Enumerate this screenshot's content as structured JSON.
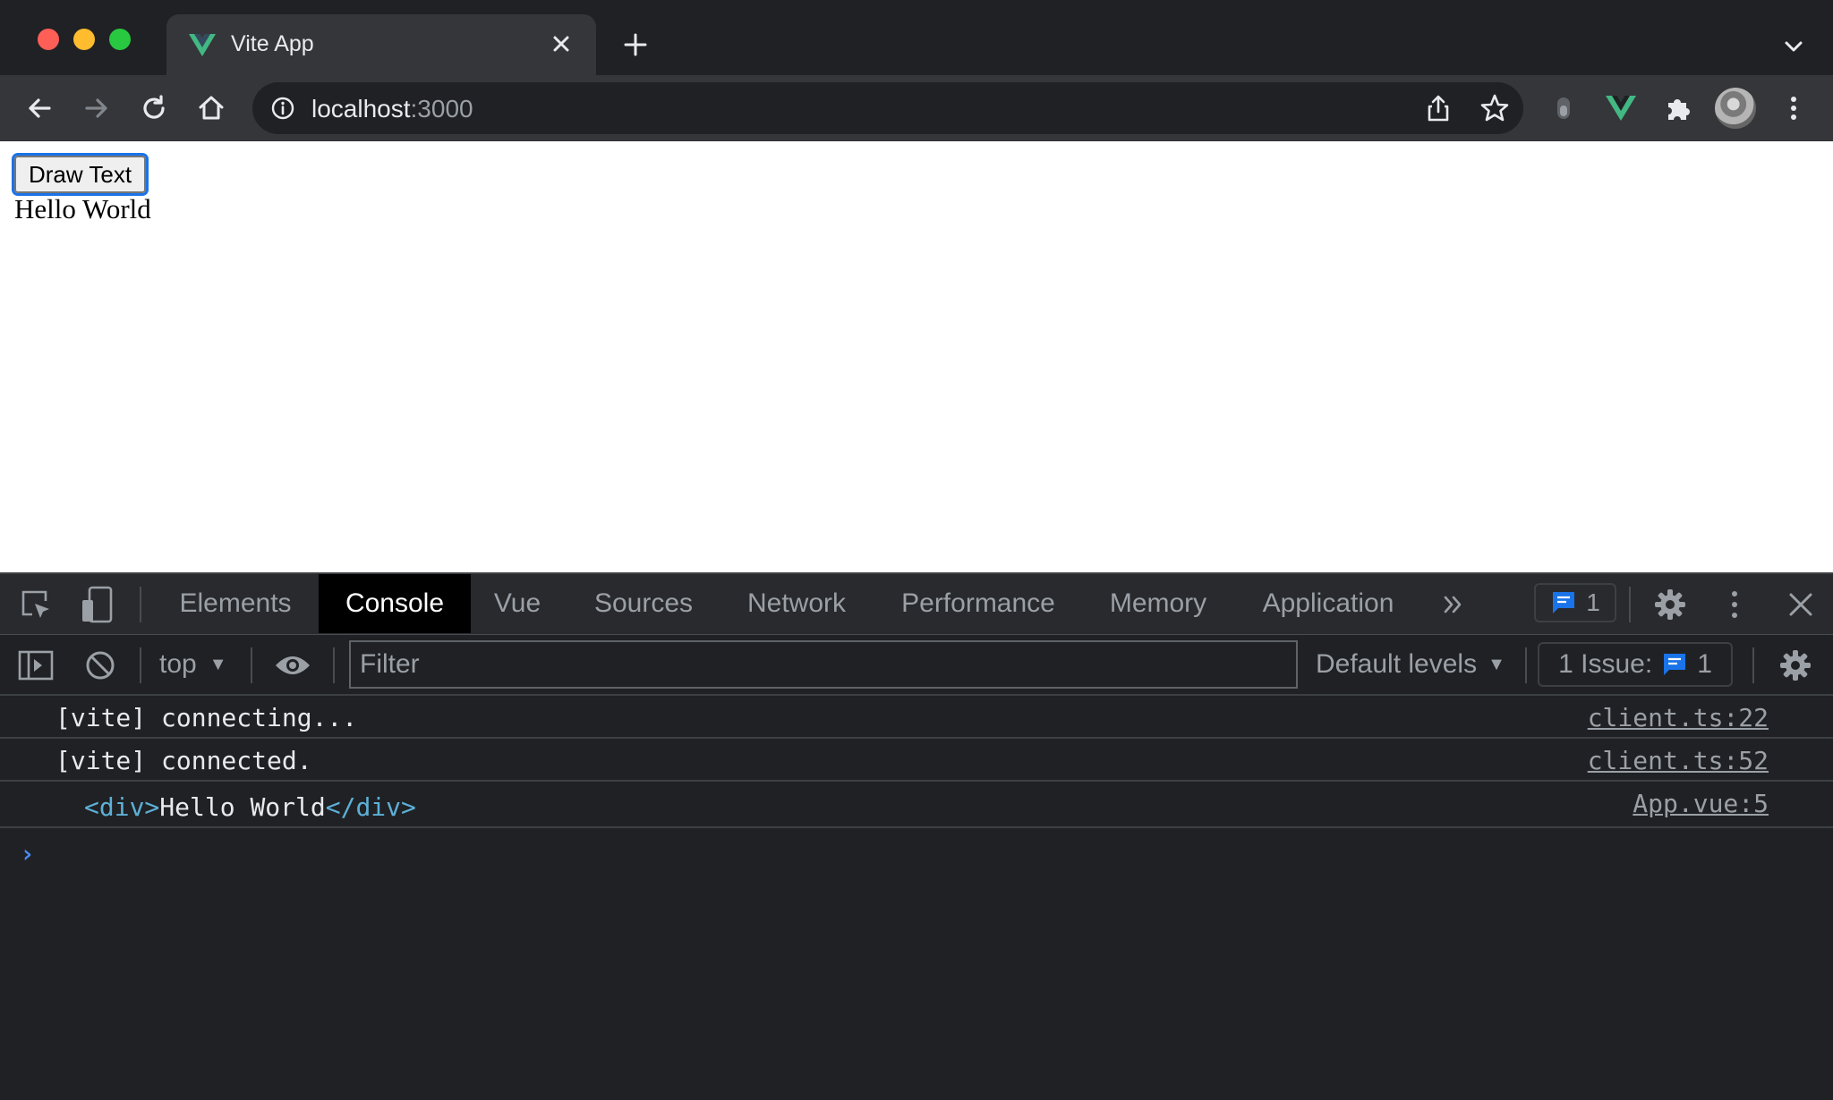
{
  "browser": {
    "tab": {
      "title": "Vite App"
    },
    "address": {
      "host": "localhost",
      "port": ":3000"
    }
  },
  "page": {
    "button_label": "Draw Text",
    "text": "Hello World"
  },
  "devtools": {
    "tabs": [
      "Elements",
      "Console",
      "Vue",
      "Sources",
      "Network",
      "Performance",
      "Memory",
      "Application"
    ],
    "issues_count": "1",
    "context": "top",
    "filter_placeholder": "Filter",
    "levels": "Default levels",
    "issues_label": "1 Issue:",
    "console": [
      {
        "text": "[vite] connecting...",
        "source": "client.ts:22"
      },
      {
        "text": "[vite] connected.",
        "source": "client.ts:52"
      },
      {
        "tag_open": "<div>",
        "inner": "Hello World",
        "tag_close": "</div>",
        "source": "App.vue:5"
      }
    ],
    "prompt": "›"
  },
  "colors": {
    "vue_green": "#42b883",
    "accent_blue": "#1a73e8",
    "close_red": "#ff5f57",
    "minimize_yellow": "#febc2e",
    "zoom_green": "#28c840"
  }
}
